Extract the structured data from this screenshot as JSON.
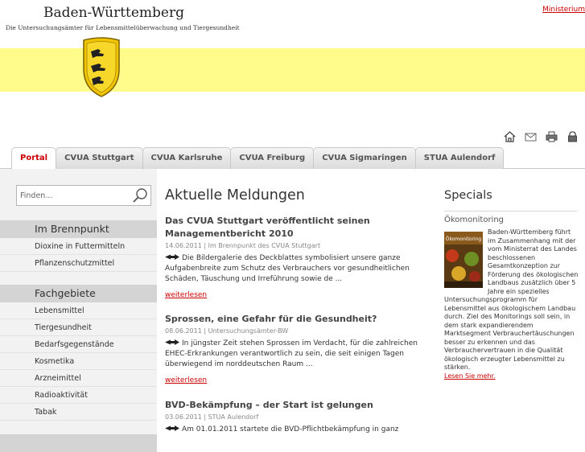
{
  "header": {
    "title": "Baden-Württemberg",
    "subtitle": "Die Untersuchungsämter für Lebensmittelüberwachung und Tiergesundheit",
    "ministry_link": "Ministerium"
  },
  "toolbar_icons": [
    "home-icon",
    "mail-icon",
    "print-icon",
    "lock-icon"
  ],
  "tabs": [
    {
      "label": "Portal",
      "active": true
    },
    {
      "label": "CVUA Stuttgart"
    },
    {
      "label": "CVUA Karlsruhe"
    },
    {
      "label": "CVUA Freiburg"
    },
    {
      "label": "CVUA Sigmaringen"
    },
    {
      "label": "STUA Aulendorf"
    }
  ],
  "search": {
    "placeholder": "Finden..."
  },
  "sidebar": {
    "brennpunkt_heading": "Im Brennpunkt",
    "brennpunkt_items": [
      "Dioxine in Futtermitteln",
      "Pflanzenschutzmittel"
    ],
    "fachgebiete_heading": "Fachgebiete",
    "fachgebiete_items": [
      "Lebensmittel",
      "Tiergesundheit",
      "Bedarfsgegenstände",
      "Kosmetika",
      "Arzneimittel",
      "Radioaktivität",
      "Tabak"
    ]
  },
  "main": {
    "title": "Aktuelle Meldungen",
    "news": [
      {
        "title": "Das CVUA Stuttgart veröffentlicht seinen Managementbericht 2010",
        "meta": "14.06.2011 | Im Brennpunkt des CVUA Stuttgart",
        "text": "Die Bildergalerie des Deckblattes symbolisiert unsere ganze Aufgabenbreite zum Schutz des Verbrauchers vor gesundheitlichen Schäden, Täuschung und Irreführung sowie de ...",
        "more": "weiterlesen"
      },
      {
        "title": "Sprossen, eine Gefahr für die Gesundheit?",
        "meta": "08.06.2011 | Untersuchungsämter-BW",
        "text": "In jüngster Zeit stehen Sprossen im Verdacht, für die zahlreichen EHEC-Erkrankungen verantwortlich zu sein, die seit einigen Tagen überwiegend im norddeutschen Raum  ...",
        "more": "weiterlesen"
      },
      {
        "title": "BVD-Bekämpfung – der Start ist gelungen",
        "meta": "03.06.2011 | STUA Aulendorf",
        "text": "Am 01.01.2011 startete die BVD-Pflichtbekämpfung in ganz",
        "more": ""
      }
    ]
  },
  "specials": {
    "title": "Specials",
    "subtitle": "Ökomonitoring",
    "thumb_label": "Ökomonitoring",
    "text": "Baden-Württemberg führt im Zusammenhang mit der vom Ministerrat des Landes beschlossenen Gesamtkonzeption zur Förderung des ökologischen Landbaus zusätzlich über 5 Jahre ein spezielles Untersuchungsprogramm für Lebensmittel aus ökologischem Landbau durch. Ziel des Monitorings soll sein, in dem stark expandierendem Marktsegment Verbrauchertäuschungen besser zu erkennen und das Verbrauchervertrauen in die Qualität ökologisch erzeugter Lebensmittel zu stärken.",
    "more": "Lesen Sie mehr."
  },
  "colors": {
    "accent": "#cc0000",
    "band": "#fffc8c",
    "sidebar": "#f2f2f2",
    "heading_bg": "#d4d4d4"
  }
}
